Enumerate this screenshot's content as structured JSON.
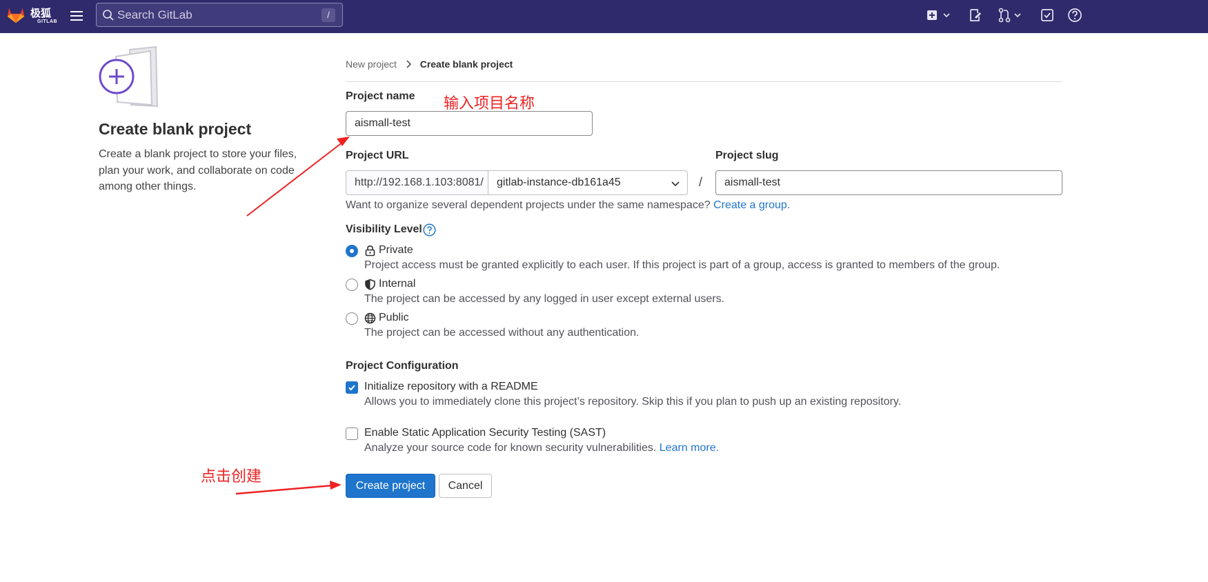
{
  "topbar": {
    "brand": "极狐",
    "brand_sub": "GITLAB",
    "search_placeholder": "Search GitLab",
    "search_shortcut": "/",
    "icons": [
      "hamburger-icon",
      "search-icon",
      "plus-square-icon",
      "issues-icon",
      "merge-request-icon",
      "todo-icon",
      "help-icon"
    ]
  },
  "left": {
    "title": "Create blank project",
    "description": "Create a blank project to store your files, plan your work, and collaborate on code among other things."
  },
  "breadcrumb": {
    "items": [
      "New project",
      "Create blank project"
    ]
  },
  "form": {
    "project_name_label": "Project name",
    "project_name_value": "aismall-test",
    "project_url_label": "Project URL",
    "url_prefix": "http://192.168.1.103:8081/",
    "namespace": "gitlab-instance-db161a45",
    "slug_separator": "/",
    "project_slug_label": "Project slug",
    "project_slug_value": "aismall-test",
    "namespace_hint": "Want to organize several dependent projects under the same namespace?",
    "create_group_link": "Create a group.",
    "visibility_label": "Visibility Level",
    "visibility": [
      {
        "label": "Private",
        "checked": true,
        "icon": "lock-icon",
        "description": "Project access must be granted explicitly to each user. If this project is part of a group, access is granted to members of the group."
      },
      {
        "label": "Internal",
        "checked": false,
        "icon": "shield-icon",
        "description": "The project can be accessed by any logged in user except external users."
      },
      {
        "label": "Public",
        "checked": false,
        "icon": "globe-icon",
        "description": "The project can be accessed without any authentication."
      }
    ],
    "config_label": "Project Configuration",
    "readme_label": "Initialize repository with a README",
    "readme_checked": true,
    "readme_desc": "Allows you to immediately clone this project’s repository. Skip this if you plan to push up an existing repository.",
    "sast_label": "Enable Static Application Security Testing (SAST)",
    "sast_checked": false,
    "sast_desc": "Analyze your source code for known security vulnerabilities.",
    "learn_more_link": "Learn more.",
    "create_button": "Create project",
    "cancel_button": "Cancel"
  },
  "annotations": {
    "name_hint": "输入项目名称",
    "create_hint": "点击创建"
  },
  "colors": {
    "topbar": "#2f2a6b",
    "primary": "#1f75cb",
    "annotation": "#ee2222",
    "illustration": "#6e49cb"
  }
}
